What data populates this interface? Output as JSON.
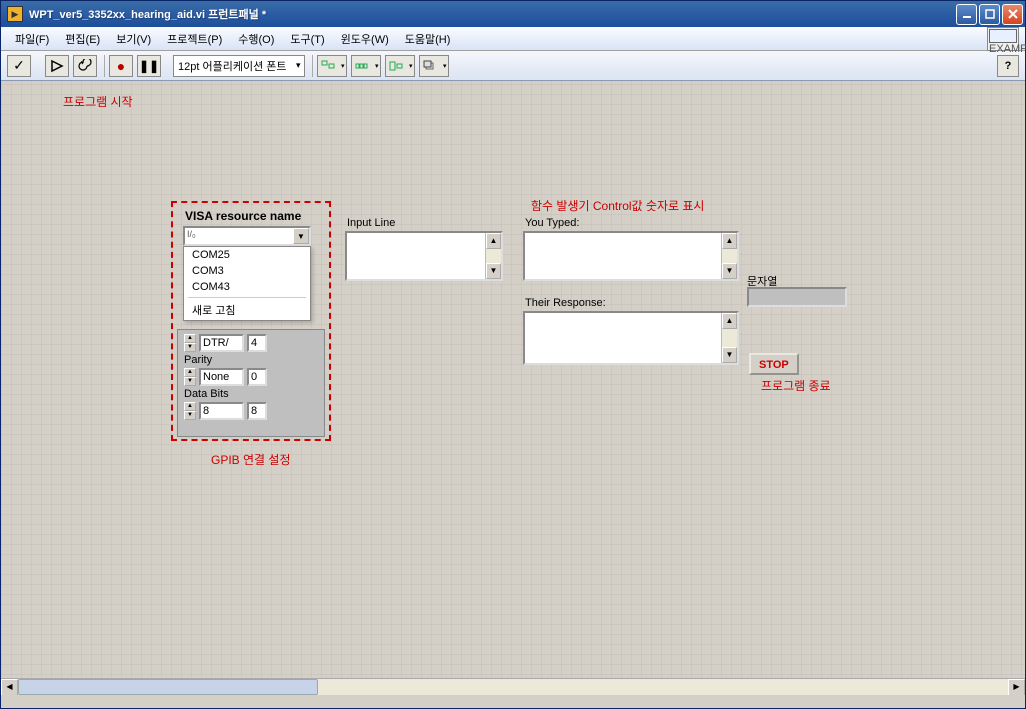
{
  "titlebar": {
    "title": "WPT_ver5_3352xx_hearing_aid.vi 프런트패널 *"
  },
  "menu": {
    "file": "파일(F)",
    "edit": "편집(E)",
    "view": "보기(V)",
    "project": "프로젝트(P)",
    "execute": "수행(O)",
    "tool": "도구(T)",
    "window": "윈도우(W)",
    "help": "도움말(H)"
  },
  "toolbar": {
    "font": "12pt 어플리케이션 폰트"
  },
  "annotations": {
    "program_start": "프로그램 시작",
    "gpib_setting": "GPIB 연결 설정",
    "control_value": "함수 발생기 Control값 숫자로 표시",
    "program_end": "프로그램 종료"
  },
  "visa": {
    "label": "VISA resource name",
    "value": "",
    "options": [
      "COM25",
      "COM3",
      "COM43"
    ],
    "refresh": "새로 고침",
    "dtr_label": "DTR/",
    "dtr_value": "4",
    "parity_label": "Parity",
    "parity_value": "None",
    "parity_num": "0",
    "databits_label": "Data Bits",
    "databits_value": "8",
    "databits_num": "8"
  },
  "io": {
    "input_line_label": "Input Line",
    "you_typed_label": "You Typed:",
    "their_response_label": "Their Response:",
    "string_label": "문자열",
    "stop": "STOP"
  },
  "example_badge": "EXAMPLE"
}
